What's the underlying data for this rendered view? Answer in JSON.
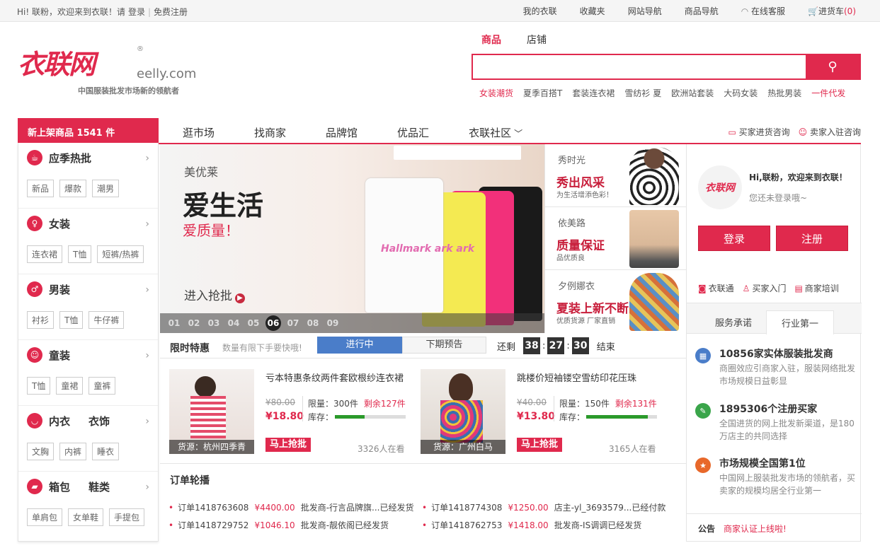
{
  "topbar": {
    "greeting": "Hi! 联粉，欢迎来到衣联！请",
    "login": "登录",
    "register": "免费注册",
    "links": [
      "我的衣联",
      "收藏夹",
      "网站导航",
      "商品导航",
      "在线客服"
    ],
    "cart_label": "进货车",
    "cart_count": "(0)"
  },
  "logo": {
    "mark": "衣联网",
    "reg": "®",
    "domain": "eelly.com",
    "slogan": "中国服装批发市场新的领航者"
  },
  "search": {
    "tabs": [
      "商品",
      "店铺"
    ],
    "placeholder": "",
    "hotwords": [
      "女装潮货",
      "夏季百搭T",
      "套装连衣裙",
      "雪纺衫 夏",
      "欧洲站套装",
      "大码女装",
      "热批男装",
      "一件代发"
    ]
  },
  "categories": {
    "header": "新上架商品 1541 件",
    "items": [
      {
        "name": "应季热批",
        "extra": "",
        "icon": "cup-icon",
        "tags": [
          "新品",
          "爆款",
          "潮男"
        ]
      },
      {
        "name": "女装",
        "extra": "",
        "icon": "dress-icon",
        "tags": [
          "连衣裙",
          "T恤",
          "短裤/热裤"
        ]
      },
      {
        "name": "男装",
        "extra": "",
        "icon": "shirt-icon",
        "tags": [
          "衬衫",
          "T恤",
          "牛仔裤"
        ]
      },
      {
        "name": "童装",
        "extra": "",
        "icon": "baby-icon",
        "tags": [
          "T恤",
          "童裙",
          "童裤"
        ]
      },
      {
        "name": "内衣",
        "extra": "衣饰",
        "icon": "underwear-icon",
        "tags": [
          "文胸",
          "内裤",
          "睡衣"
        ]
      },
      {
        "name": "箱包",
        "extra": "鞋类",
        "icon": "shoe-icon",
        "tags": [
          "单肩包",
          "女单鞋",
          "手提包"
        ]
      }
    ]
  },
  "mainnav": {
    "items": [
      "逛市场",
      "找商家",
      "品牌馆",
      "优品汇",
      "衣联社区"
    ],
    "links": [
      "买家进货咨询",
      "卖家入驻咨询"
    ]
  },
  "banner": {
    "brand": "美优莱",
    "headline": "爱生活",
    "sub": "爱质量！",
    "cta": "进入抢批",
    "print": "Hallmark ark ark",
    "pages": [
      "01",
      "02",
      "03",
      "04",
      "05",
      "06",
      "07",
      "08",
      "09"
    ],
    "active_page": "06"
  },
  "side_promos": [
    {
      "name": "秀时光",
      "title": "秀出风采",
      "desc": "为生活增添色彩！"
    },
    {
      "name": "依美路",
      "title": "质量保证",
      "desc": "品优质良"
    },
    {
      "name": "夕例娜衣",
      "title": "夏装上新不断",
      "desc": "优质货源  厂家直销"
    }
  ],
  "user": {
    "avatar_text": "衣联网",
    "welcome": "Hi,联粉，欢迎来到衣联！",
    "status": "您还未登录哦~",
    "login": "登录",
    "register": "注册",
    "links": [
      "衣联通",
      "买家入门",
      "商家培训"
    ],
    "tabs": [
      "服务承诺",
      "行业第一"
    ],
    "promises": [
      {
        "title": "10856家实体服装批发商",
        "desc": "商圈效应引商家入驻，服装网络批发市场规模日益彰显",
        "color": "#4a7dc9"
      },
      {
        "title": "1895306个注册买家",
        "desc": "全国进货的网上批发新渠道，是180万店主的共同选择",
        "color": "#3aa54a"
      },
      {
        "title": "市场规模全国第1位",
        "desc": "中国网上服装批发市场的领航者，买卖家的规模均居全行业第一",
        "color": "#e8682a"
      }
    ],
    "notice_label": "公告",
    "notice_text": "商家认证上线啦!"
  },
  "flash": {
    "title": "限时特惠",
    "tip": "数量有限下手要快哦!",
    "tab_active": "进行中",
    "tab_next": "下期预告",
    "countdown_prefix": "还剩",
    "hours": "38",
    "minutes": "27",
    "seconds": "30",
    "countdown_suffix": "结束",
    "products": [
      {
        "name": "亏本特惠条纹两件套欧根纱连衣裙",
        "old": "¥80.00",
        "price": "¥18.80",
        "limit": "限量：300件",
        "left": "剩余127件",
        "stock_label": "库存：",
        "stock": 0.42,
        "buy": "马上抢批",
        "watch": "3326人在看",
        "source": "货源：杭州四季青"
      },
      {
        "name": "跳楼价短袖镂空雪纺印花压珠",
        "old": "¥40.00",
        "price": "¥13.80",
        "limit": "限量：150件",
        "left": "剩余131件",
        "stock_label": "库存：",
        "stock": 0.87,
        "buy": "马上抢批",
        "watch": "3165人在看",
        "source": "货源：广州白马"
      }
    ]
  },
  "orders": {
    "title": "订单轮播",
    "rows": [
      {
        "id": "订单1418763608",
        "amount": "¥4400.00",
        "text": "批发商-行言品牌旗...已经发货"
      },
      {
        "id": "订单1418774308",
        "amount": "¥1250.00",
        "text": "店主-yl_3693579...已经付款"
      },
      {
        "id": "订单1418729752",
        "amount": "¥1046.10",
        "text": "批发商-靓依阁已经发货"
      },
      {
        "id": "订单1418762753",
        "amount": "¥1418.00",
        "text": "批发商-IS调调已经发货"
      }
    ]
  },
  "colors": {
    "accent": "#e0294d",
    "blue": "#4a7dc9",
    "green": "#2b9a2b"
  }
}
